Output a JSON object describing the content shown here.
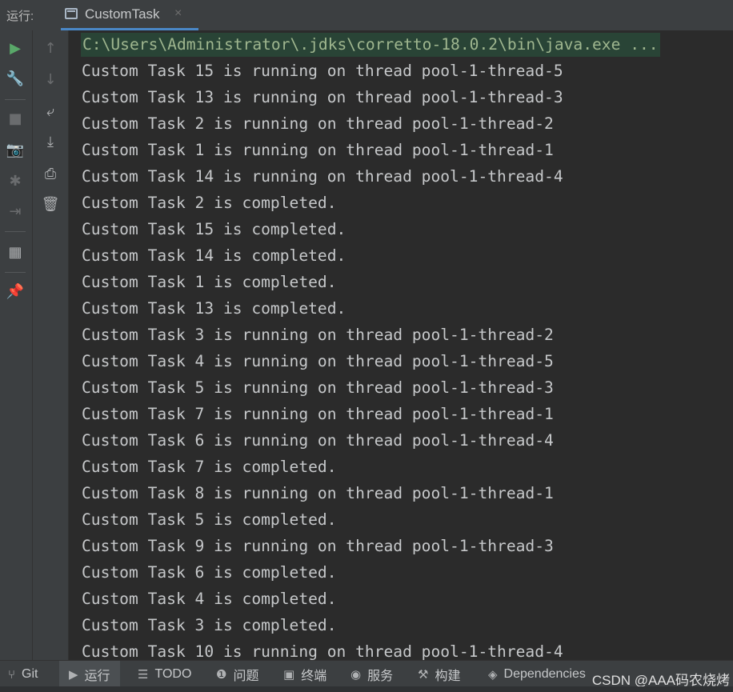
{
  "header": {
    "label": "运行:",
    "tab": {
      "label": "CustomTask",
      "close": "×"
    }
  },
  "toolbar": {
    "main": [
      {
        "name": "rerun-icon",
        "glyph": "▶"
      },
      {
        "name": "wrench-icon",
        "glyph": "🔧"
      },
      {
        "name": "stop-icon",
        "glyph": "■"
      },
      {
        "name": "camera-icon",
        "glyph": "📷"
      },
      {
        "name": "debug-icon",
        "glyph": "✱"
      },
      {
        "name": "login-icon",
        "glyph": "⇥"
      },
      {
        "name": "layout-icon",
        "glyph": "▦"
      },
      {
        "name": "pin-icon",
        "glyph": "📌"
      }
    ],
    "console": [
      {
        "name": "up-arrow-icon",
        "glyph": "↑"
      },
      {
        "name": "down-arrow-icon",
        "glyph": "↓"
      },
      {
        "name": "soft-wrap-icon",
        "glyph": "⤶"
      },
      {
        "name": "scroll-to-end-icon",
        "glyph": "⤓"
      },
      {
        "name": "print-icon",
        "glyph": "⎙"
      },
      {
        "name": "trash-icon",
        "glyph": "🗑"
      }
    ]
  },
  "console": {
    "command": "C:\\Users\\Administrator\\.jdks\\corretto-18.0.2\\bin\\java.exe ...",
    "lines": [
      "Custom Task 15 is running on thread pool-1-thread-5",
      "Custom Task 13 is running on thread pool-1-thread-3",
      "Custom Task 2 is running on thread pool-1-thread-2",
      "Custom Task 1 is running on thread pool-1-thread-1",
      "Custom Task 14 is running on thread pool-1-thread-4",
      "Custom Task 2 is completed.",
      "Custom Task 15 is completed.",
      "Custom Task 14 is completed.",
      "Custom Task 1 is completed.",
      "Custom Task 13 is completed.",
      "Custom Task 3 is running on thread pool-1-thread-2",
      "Custom Task 4 is running on thread pool-1-thread-5",
      "Custom Task 5 is running on thread pool-1-thread-3",
      "Custom Task 7 is running on thread pool-1-thread-1",
      "Custom Task 6 is running on thread pool-1-thread-4",
      "Custom Task 7 is completed.",
      "Custom Task 8 is running on thread pool-1-thread-1",
      "Custom Task 5 is completed.",
      "Custom Task 9 is running on thread pool-1-thread-3",
      "Custom Task 6 is completed.",
      "Custom Task 4 is completed.",
      "Custom Task 3 is completed.",
      "Custom Task 10 is running on thread pool-1-thread-4"
    ]
  },
  "bottom": {
    "tabs": [
      {
        "label": "Git",
        "icon": "git-branch-icon",
        "glyph": "⑂"
      },
      {
        "label": "运行",
        "icon": "run-icon",
        "glyph": "▶"
      },
      {
        "label": "TODO",
        "icon": "todo-list-icon",
        "glyph": "☰"
      },
      {
        "label": "问题",
        "icon": "problems-icon",
        "glyph": "❶"
      },
      {
        "label": "终端",
        "icon": "terminal-icon",
        "glyph": "▣"
      },
      {
        "label": "服务",
        "icon": "services-icon",
        "glyph": "◉"
      },
      {
        "label": "构建",
        "icon": "build-hammer-icon",
        "glyph": "⚒"
      },
      {
        "label": "Dependencies",
        "icon": "dependencies-icon",
        "glyph": "◈"
      }
    ],
    "watermark": "CSDN @AAA码农烧烤"
  }
}
